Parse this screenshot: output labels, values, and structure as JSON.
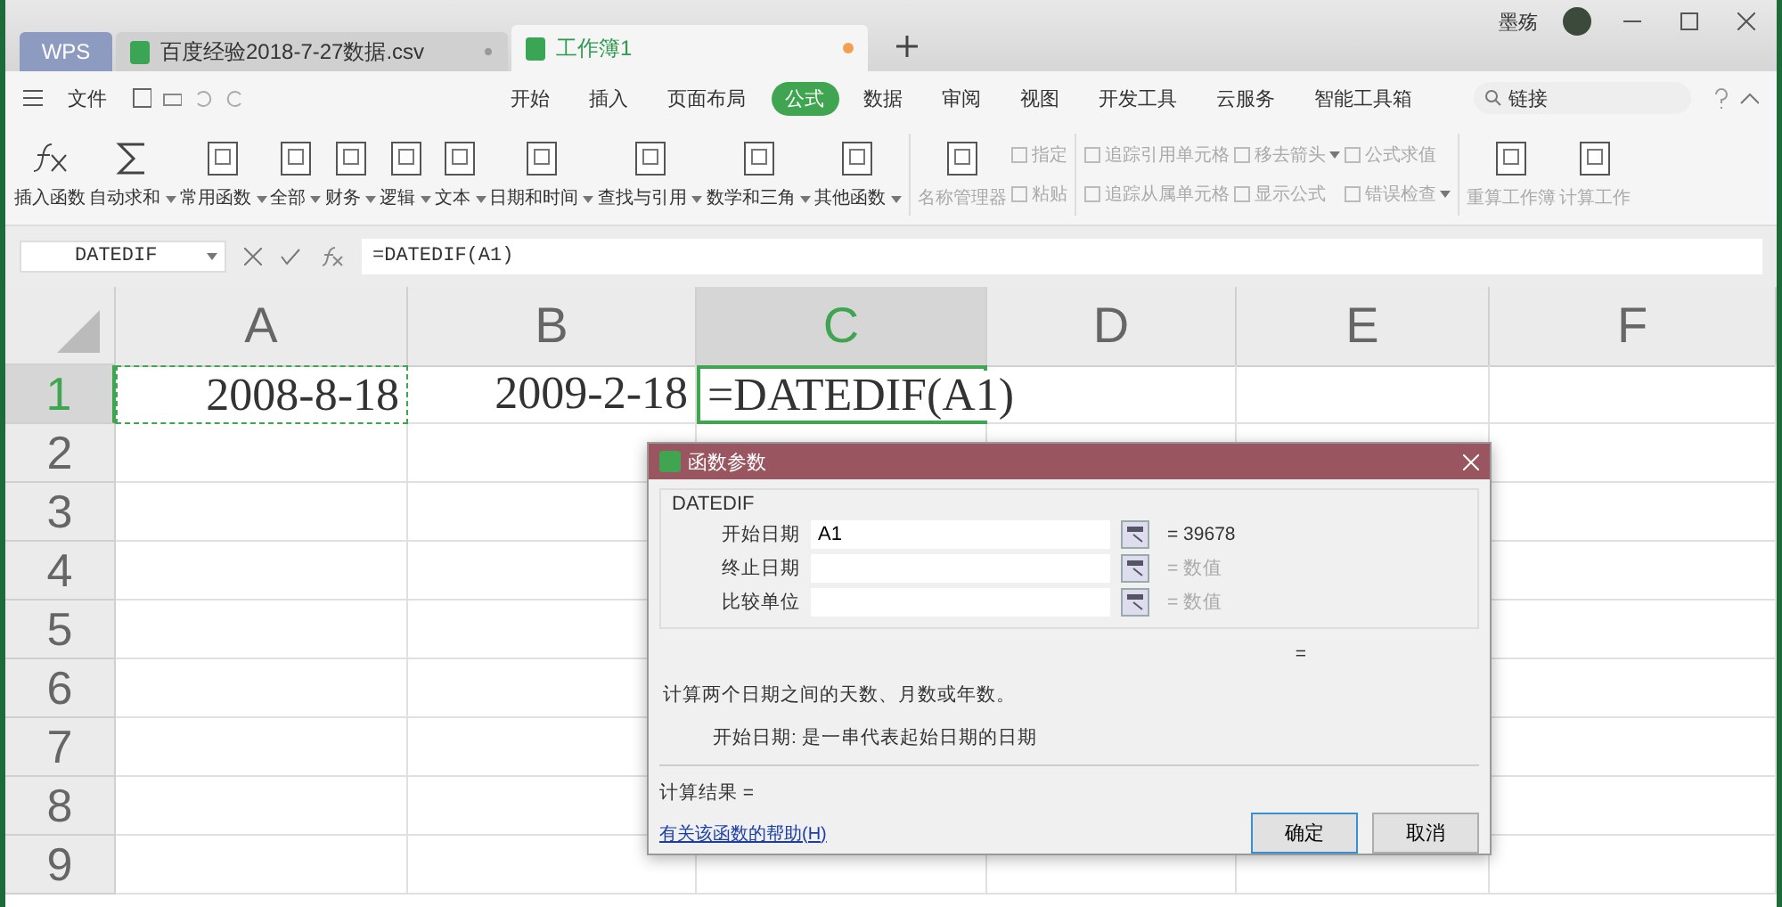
{
  "title_bar": {
    "home_tab": "WPS",
    "tabs": [
      {
        "label": "百度经验2018-7-27数据.csv",
        "selected": false
      },
      {
        "label": "工作簿1",
        "selected": true
      }
    ],
    "user": "墨殇"
  },
  "menu": {
    "file": "文件",
    "tabs": [
      {
        "label": "开始",
        "selected": false
      },
      {
        "label": "插入",
        "selected": false
      },
      {
        "label": "页面布局",
        "selected": false
      },
      {
        "label": "公式",
        "selected": true
      },
      {
        "label": "数据",
        "selected": false
      },
      {
        "label": "审阅",
        "selected": false
      },
      {
        "label": "视图",
        "selected": false
      },
      {
        "label": "开发工具",
        "selected": false
      },
      {
        "label": "云服务",
        "selected": false
      },
      {
        "label": "智能工具箱",
        "selected": false
      }
    ],
    "search": "链接"
  },
  "ribbon": {
    "functions": [
      {
        "label": "插入函数",
        "dropdown": false,
        "kind": "fx"
      },
      {
        "label": "自动求和",
        "dropdown": true,
        "kind": "sum"
      },
      {
        "label": "常用函数",
        "dropdown": true,
        "kind": "book"
      },
      {
        "label": "全部",
        "dropdown": true,
        "kind": "book"
      },
      {
        "label": "财务",
        "dropdown": true,
        "kind": "book"
      },
      {
        "label": "逻辑",
        "dropdown": true,
        "kind": "book"
      },
      {
        "label": "文本",
        "dropdown": true,
        "kind": "book"
      },
      {
        "label": "日期和时间",
        "dropdown": true,
        "kind": "book"
      },
      {
        "label": "查找与引用",
        "dropdown": true,
        "kind": "book"
      },
      {
        "label": "数学和三角",
        "dropdown": true,
        "kind": "book"
      },
      {
        "label": "其他函数",
        "dropdown": true,
        "kind": "book"
      }
    ],
    "name_manager": "名称管理器",
    "small_tools": [
      [
        {
          "label": "指定",
          "dropdown": false
        },
        {
          "label": "粘贴",
          "dropdown": false
        }
      ],
      [
        {
          "label": "追踪引用单元格",
          "dropdown": false
        },
        {
          "label": "追踪从属单元格",
          "dropdown": false
        }
      ],
      [
        {
          "label": "移去箭头",
          "dropdown": true
        },
        {
          "label": "显示公式",
          "dropdown": false
        }
      ],
      [
        {
          "label": "公式求值",
          "dropdown": false
        },
        {
          "label": "错误检查",
          "dropdown": true
        }
      ]
    ],
    "calc": [
      "重算工作簿",
      "计算工作"
    ]
  },
  "formula_bar": {
    "name_box": "DATEDIF",
    "formula": "=DATEDIF(A1)"
  },
  "sheet": {
    "columns": [
      {
        "label": "A",
        "selected": false
      },
      {
        "label": "B",
        "selected": false
      },
      {
        "label": "C",
        "selected": true
      },
      {
        "label": "D",
        "selected": false
      },
      {
        "label": "E",
        "selected": false
      },
      {
        "label": "F",
        "selected": false
      }
    ],
    "rows": [
      {
        "label": "1",
        "selected": true,
        "cells": [
          "2008-8-18",
          "2009-2-18",
          "=DATEDIF(A1)"
        ]
      },
      {
        "label": "2",
        "selected": false,
        "cells": []
      },
      {
        "label": "3",
        "selected": false,
        "cells": []
      },
      {
        "label": "4",
        "selected": false,
        "cells": []
      },
      {
        "label": "5",
        "selected": false,
        "cells": []
      },
      {
        "label": "6",
        "selected": false,
        "cells": []
      },
      {
        "label": "7",
        "selected": false,
        "cells": []
      },
      {
        "label": "8",
        "selected": false,
        "cells": []
      },
      {
        "label": "9",
        "selected": false,
        "cells": []
      }
    ]
  },
  "dialog": {
    "title": "函数参数",
    "group": "DATEDIF",
    "args": [
      {
        "label": "开始日期",
        "value": "A1",
        "result": "= 39678",
        "dimmed": false
      },
      {
        "label": "终止日期",
        "result": "= 数值",
        "dimmed": true
      },
      {
        "label": "比较单位",
        "result": "= 数值",
        "dimmed": true
      }
    ],
    "total": "=",
    "description": "计算两个日期之间的天数、月数或年数。",
    "arg_help": "开始日期:  是一串代表起始日期的日期",
    "result": "计算结果 =",
    "help_link": "有关该函数的帮助(H)",
    "buttons": [
      {
        "label": "确定",
        "selected": true
      },
      {
        "label": "取消",
        "selected": false
      }
    ]
  }
}
